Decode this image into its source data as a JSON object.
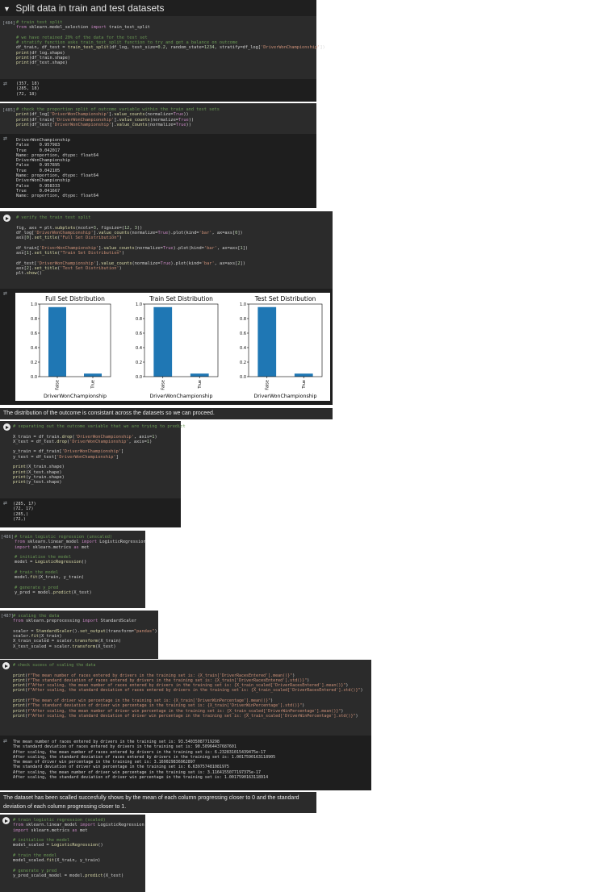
{
  "section": {
    "title": "Split data in train and test datasets"
  },
  "cells": {
    "c484": {
      "exec": "[484]",
      "output": "(357, 18)\n(285, 18)\n(72, 18)"
    },
    "c485": {
      "exec": "[485]",
      "output": "DriverWonChampionship\nFalse    0.957983\nTrue     0.042017\nName: proportion, dtype: float64\nDriverWonChampionship\nFalse    0.957895\nTrue     0.042105\nName: proportion, dtype: float64\nDriverWonChampionship\nFalse    0.958333\nTrue     0.041667\nName: proportion, dtype: float64"
    },
    "c_split": {
      "output": "(285, 17)\n(72, 17)\n(285,)\n(72,)"
    },
    "c486": {
      "exec": "[486]"
    },
    "c487": {
      "exec": "[487]"
    },
    "c_check": {
      "output": "The mean number of races entered by drivers in the training set is: 93.54035087719298\nThe standard deviation of races entered by drivers in the training set is: 90.50964437687601\nAfter scaling, the mean number of races entered by drivers in the training set is: 6.232831015439475e-17\nAfter scaling, the standard deviation of races entered by drivers in the training set is: 1.0017590163118905\nThe mean of driver win percentage in the training set is: 3.169029836962897\nThe standard deviation of driver win percentage in the training set is: 6.639757481081975\nAfter scaling, the mean number of driver win percentage in the training set is: 3.1164155077197375e-17\nAfter scaling, the standard deviation of driver win percentage in the training set is: 1.0017590163118914"
    }
  },
  "markdown": {
    "distribution_note": "The distribution of the outcome is consistant across the datasets so we can proceed.",
    "scaling_note": "The dataset has been scalled succesfully shows by the mean of each column progressing closer to 0 and the standard deviation of each column progressing closer to 1."
  },
  "chart_data": [
    {
      "type": "bar",
      "title": "Full Set Distribution",
      "categories": [
        "False",
        "True"
      ],
      "values": [
        0.957983,
        0.042017
      ],
      "xlabel": "DriverWonChampionship",
      "ylabel": "",
      "ylim": [
        0,
        1.0
      ],
      "yticks": [
        "0.0",
        "0.2",
        "0.4",
        "0.6",
        "0.8",
        "1.0"
      ],
      "color": "#1f77b4"
    },
    {
      "type": "bar",
      "title": "Train Set Distribution",
      "categories": [
        "False",
        "True"
      ],
      "values": [
        0.957895,
        0.042105
      ],
      "xlabel": "DriverWonChampionship",
      "ylabel": "",
      "ylim": [
        0,
        1.0
      ],
      "yticks": [
        "0.0",
        "0.2",
        "0.4",
        "0.6",
        "0.8",
        "1.0"
      ],
      "color": "#1f77b4"
    },
    {
      "type": "bar",
      "title": "Test Set Distribution",
      "categories": [
        "False",
        "True"
      ],
      "values": [
        0.958333,
        0.041667
      ],
      "xlabel": "DriverWonChampionship",
      "ylabel": "",
      "ylim": [
        0,
        1.0
      ],
      "yticks": [
        "0.0",
        "0.2",
        "0.4",
        "0.6",
        "0.8",
        "1.0"
      ],
      "color": "#1f77b4"
    }
  ]
}
